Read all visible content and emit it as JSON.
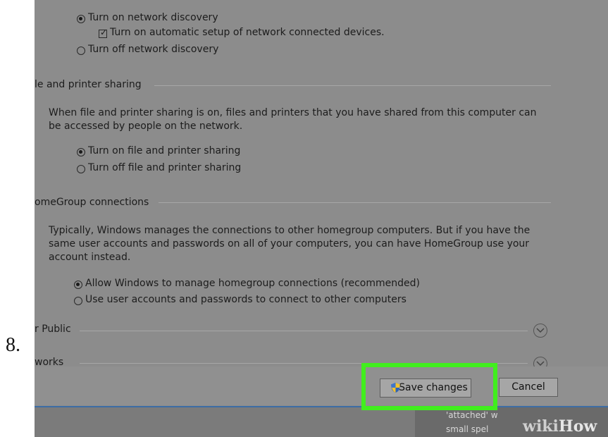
{
  "step": {
    "number": "8."
  },
  "network_discovery": {
    "option_on": "Turn on network discovery",
    "auto_setup": "Turn on automatic setup of network connected devices.",
    "option_off": "Turn off network discovery"
  },
  "file_sharing": {
    "header": "le and printer sharing",
    "description_line1": "When file and printer sharing is on, files and printers that you have shared from this computer can",
    "description_line2": "be accessed by people on the network.",
    "option_on": "Turn on file and printer sharing",
    "option_off": "Turn off file and printer sharing"
  },
  "homegroup": {
    "header": "omeGroup connections",
    "description_line1": "Typically, Windows manages the connections to other homegroup computers. But if you have the",
    "description_line2": "same user accounts and passwords on all of your computers, you can have HomeGroup use your",
    "description_line3": "account instead.",
    "option_windows": "Allow Windows to manage homegroup connections (recommended)",
    "option_accounts": "Use user accounts and passwords to connect to other computers"
  },
  "sections": {
    "public": "r Public",
    "all_networks": "works"
  },
  "buttons": {
    "save": "Save changes",
    "cancel": "Cancel"
  },
  "background_text": {
    "line1": "'attached' w",
    "line2": "small spel"
  },
  "watermark": {
    "wiki": "wiki",
    "how": "How"
  },
  "icons": {
    "shield": "shield-icon",
    "expand": "chevron-down-icon"
  },
  "colors": {
    "highlight": "#41ee1e",
    "screen_tint": "#8c8c8c"
  }
}
